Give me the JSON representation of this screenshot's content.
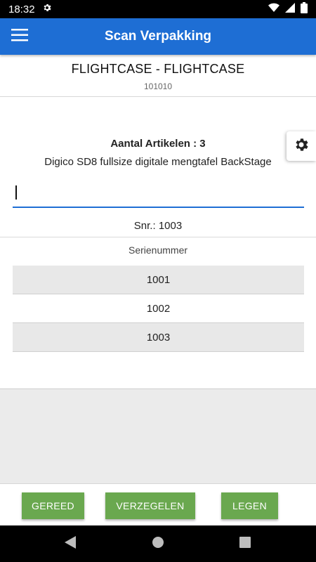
{
  "status_bar": {
    "time": "18:32",
    "icons": [
      "gear-icon",
      "wifi-icon",
      "cellular-icon",
      "battery-icon"
    ]
  },
  "app_bar": {
    "title": "Scan Verpakking",
    "menu_icon": "hamburger-menu-icon"
  },
  "header": {
    "title": "FLIGHTCASE - FLIGHTCASE",
    "code": "101010"
  },
  "settings_icon": "gear-icon",
  "content": {
    "count_label": "Aantal Artikelen : 3",
    "article": "Digico SD8 fullsize digitale mengtafel BackStage",
    "scan_input_value": "",
    "snr_label": "Snr.: 1003"
  },
  "serials": {
    "header": "Serienummer",
    "items": [
      "1001",
      "1002",
      "1003"
    ]
  },
  "buttons": {
    "ready": "GEREED",
    "seal": "VERZEGELEN",
    "empty": "LEGEN"
  },
  "colors": {
    "app_bar": "#1e6ed4",
    "button": "#6aa84f",
    "row_alt": "#e8e8e8"
  }
}
